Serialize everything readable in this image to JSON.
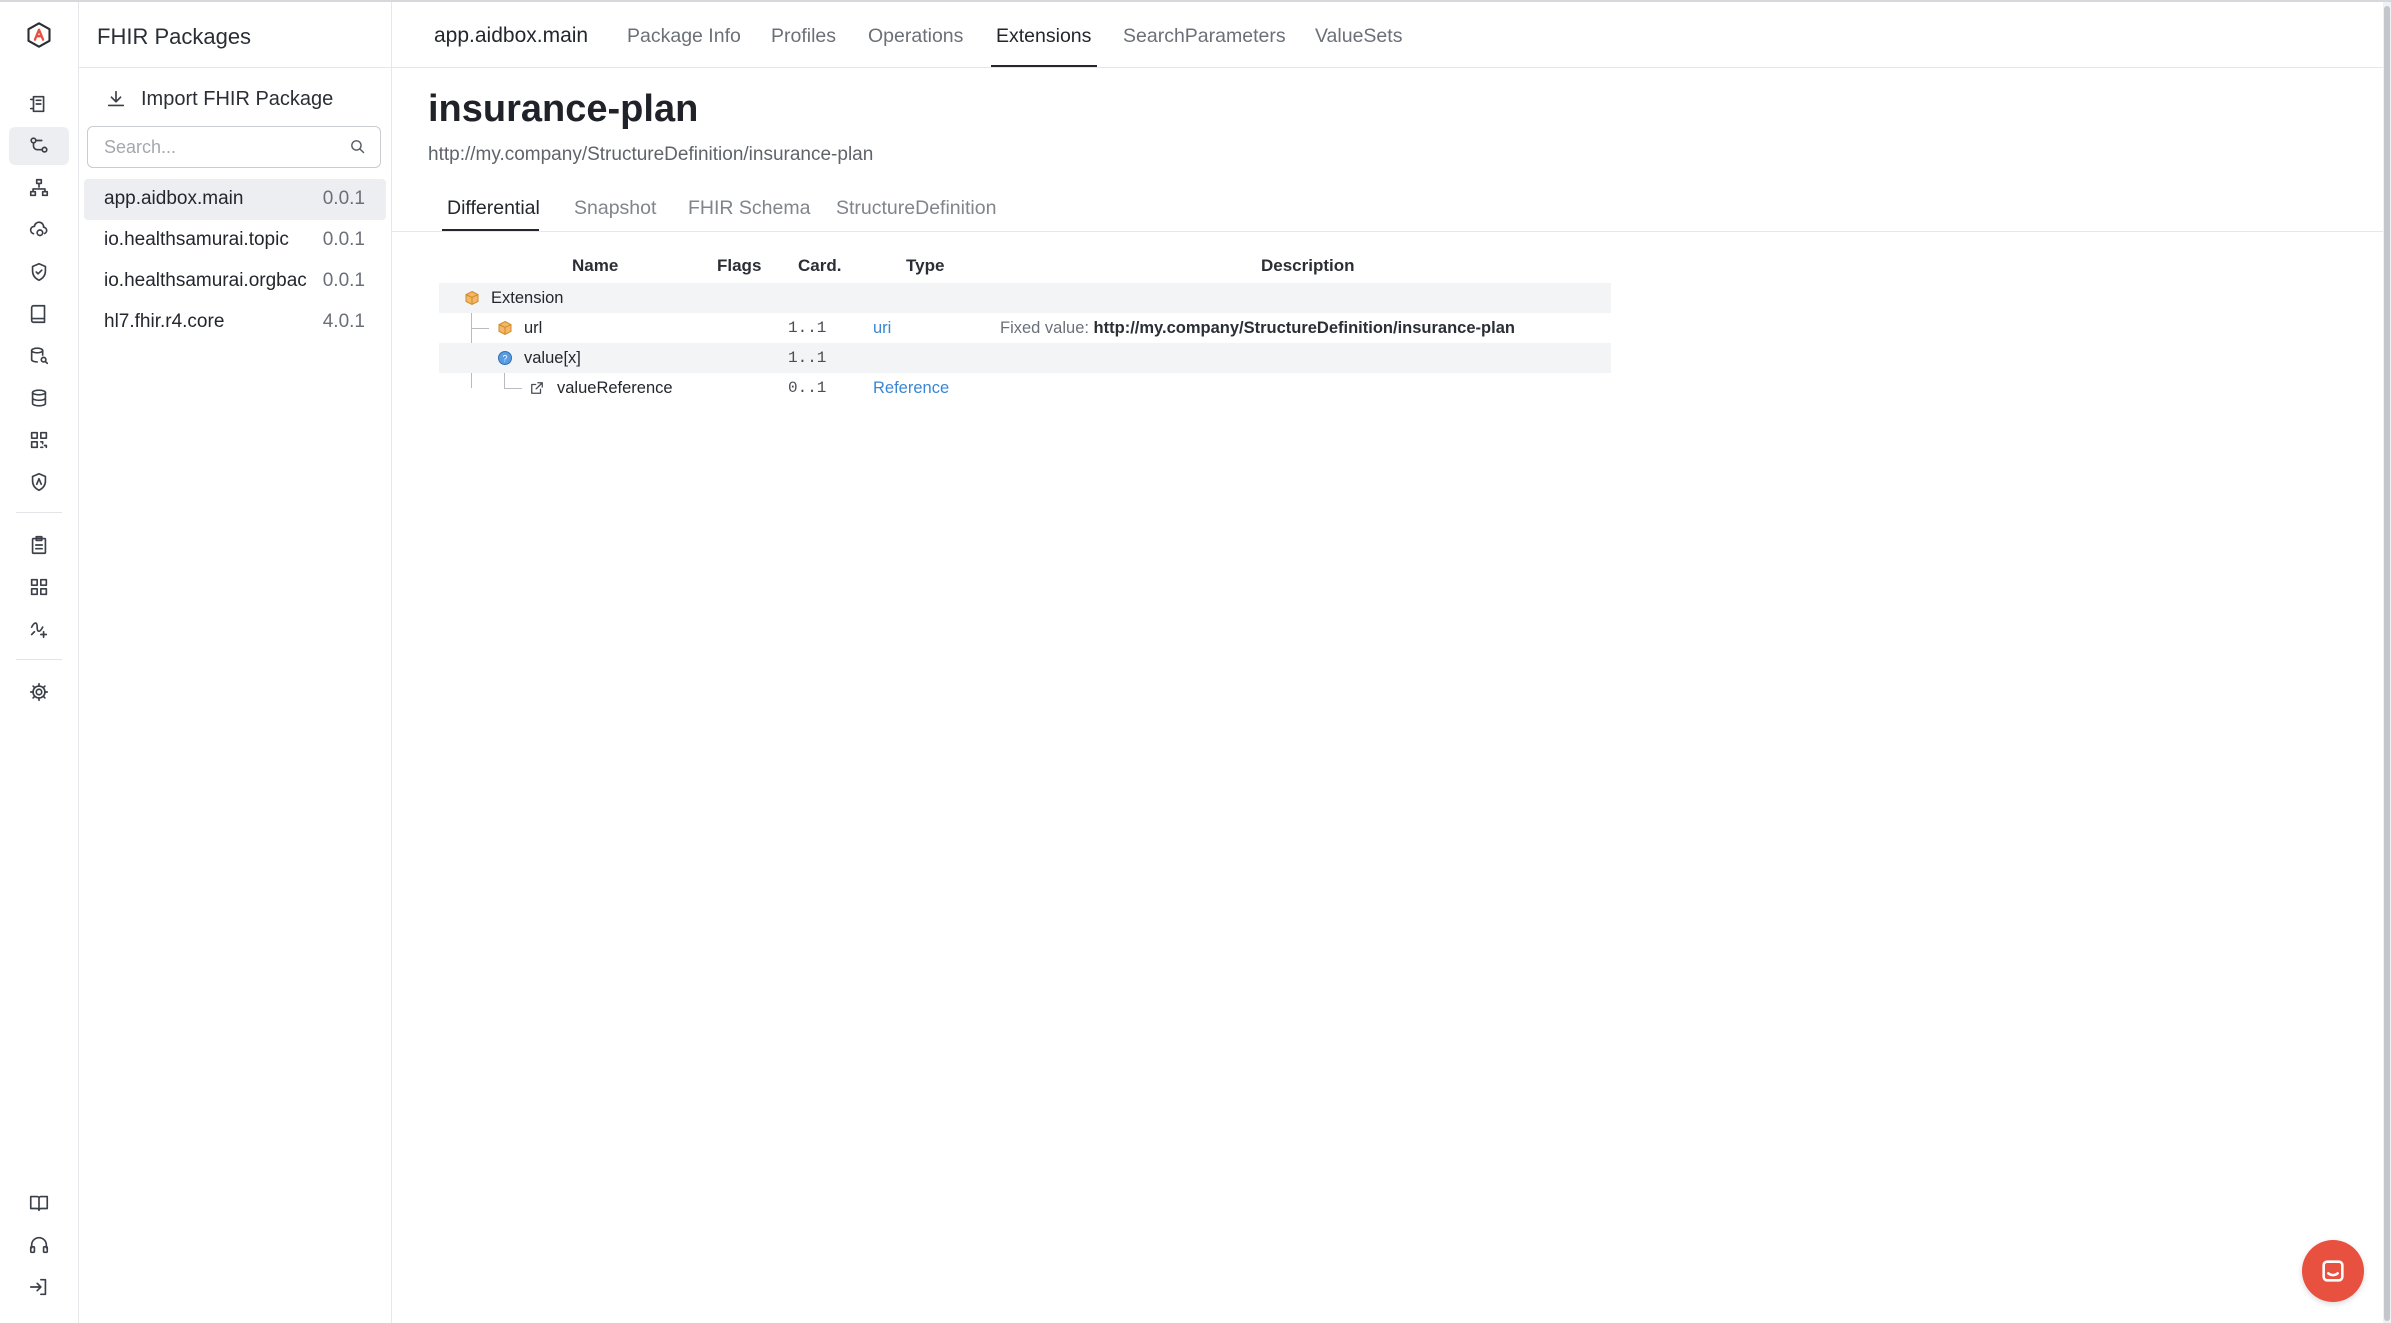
{
  "sidebar_title": "FHIR Packages",
  "import_button": "Import FHIR Package",
  "search": {
    "placeholder": "Search..."
  },
  "packages": [
    {
      "name": "app.aidbox.main",
      "version": "0.0.1"
    },
    {
      "name": "io.healthsamurai.topic",
      "version": "0.0.1"
    },
    {
      "name": "io.healthsamurai.orgbac",
      "version": "0.0.1"
    },
    {
      "name": "hl7.fhir.r4.core",
      "version": "4.0.1"
    }
  ],
  "header": {
    "package": "app.aidbox.main",
    "tabs": [
      "Package Info",
      "Profiles",
      "Operations",
      "Extensions",
      "SearchParameters",
      "ValueSets"
    ],
    "active_tab": "Extensions"
  },
  "page": {
    "title": "insurance-plan",
    "url": "http://my.company/StructureDefinition/insurance-plan"
  },
  "sub_tabs": [
    "Differential",
    "Snapshot",
    "FHIR Schema",
    "StructureDefinition"
  ],
  "active_sub_tab": "Differential",
  "table": {
    "columns": [
      "Name",
      "Flags",
      "Card.",
      "Type",
      "Description"
    ],
    "rows": [
      {
        "name": "Extension",
        "flags": "",
        "card": "",
        "type": "",
        "desc_label": "",
        "desc_value": "",
        "icon": "cube-icon"
      },
      {
        "name": "url",
        "flags": "",
        "card": "1..1",
        "type": "uri",
        "desc_label": "Fixed value: ",
        "desc_value": "http://my.company/StructureDefinition/insurance-plan",
        "icon": "cube-icon"
      },
      {
        "name": "value[x]",
        "flags": "",
        "card": "1..1",
        "type": "",
        "desc_label": "",
        "desc_value": "",
        "icon": "choice-icon"
      },
      {
        "name": "valueReference",
        "flags": "",
        "card": "0..1",
        "type": "Reference",
        "desc_label": "",
        "desc_value": "",
        "icon": "reference-icon"
      }
    ]
  },
  "colors": {
    "accent_link": "#3a86d4",
    "chat": "#e8503f",
    "cube": "#e8a43c",
    "choice": "#4a8fd8"
  }
}
